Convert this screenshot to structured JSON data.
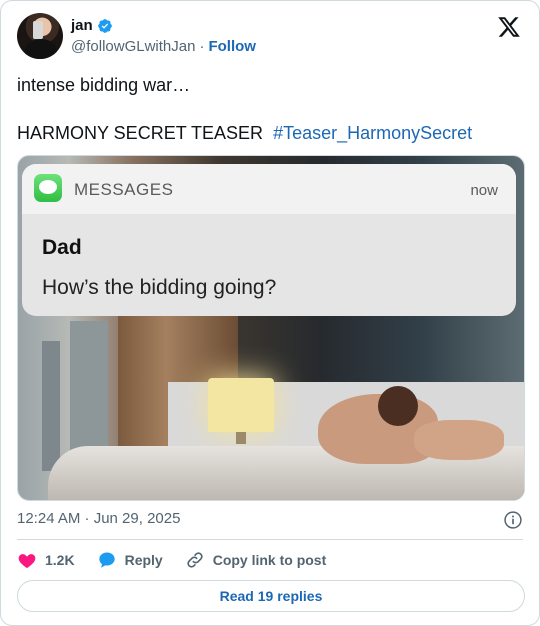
{
  "user": {
    "display_name": "jan",
    "handle": "@followGLwithJan",
    "separator": "·",
    "follow_label": "Follow"
  },
  "tweet": {
    "line1": "intense bidding war…",
    "line2_text": "HARMONY SECRET TEASER",
    "hashtag": "#Teaser_HarmonySecret"
  },
  "media": {
    "notification": {
      "app_name": "MESSAGES",
      "time": "now",
      "title": "Dad",
      "body": "How’s the bidding going?"
    }
  },
  "timestamp": "12:24 AM · Jun 29, 2025",
  "actions": {
    "like_count": "1.2K",
    "reply_label": "Reply",
    "copy_label": "Copy link to post"
  },
  "read_replies_label": "Read 19 replies",
  "colors": {
    "link": "#1d68b5",
    "like": "#f91880",
    "verified": "#1d9bf0"
  },
  "icons": [
    "verified-badge-icon",
    "x-logo-icon",
    "info-icon",
    "heart-icon",
    "reply-bubble-icon",
    "link-icon",
    "messages-app-icon"
  ]
}
